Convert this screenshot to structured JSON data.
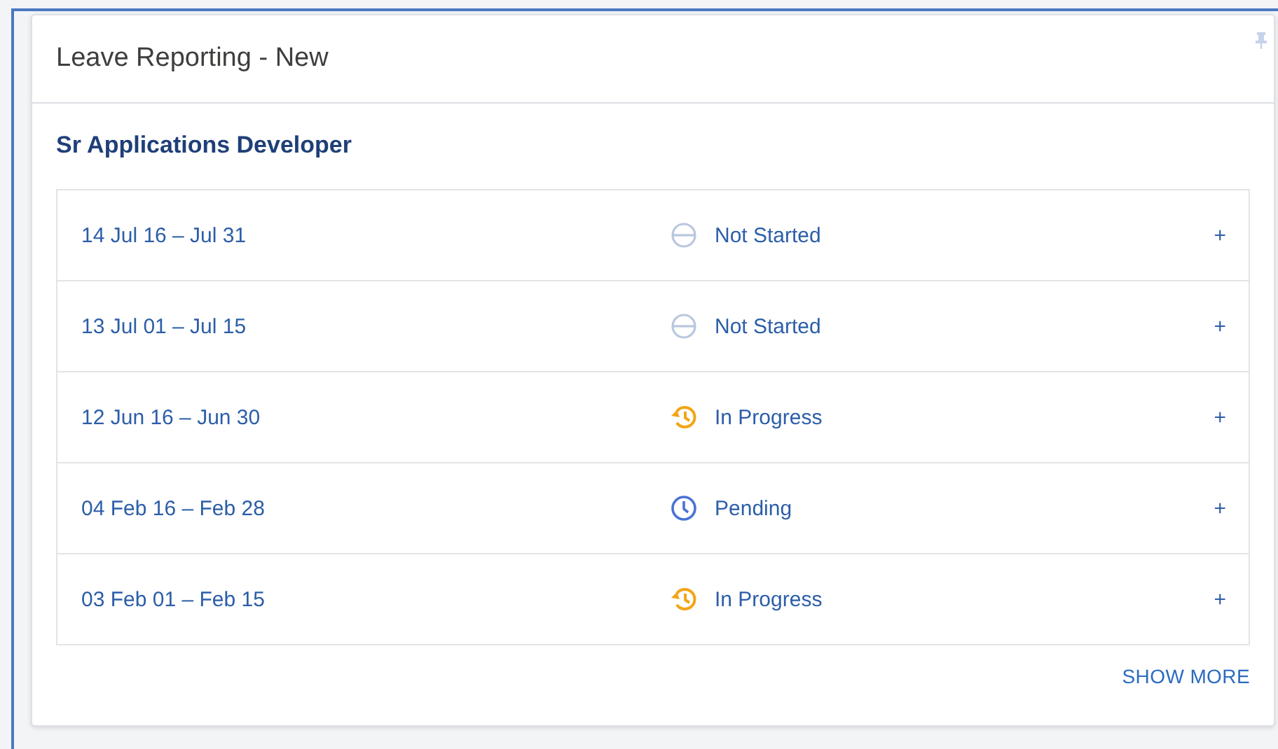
{
  "card": {
    "title": "Leave Reporting - New",
    "subtitle": "Sr Applications Developer",
    "periods": [
      {
        "label": "14 Jul 16 – Jul 31",
        "status": "Not Started",
        "kind": "not_started",
        "action": "+"
      },
      {
        "label": "13 Jul 01 – Jul 15",
        "status": "Not Started",
        "kind": "not_started",
        "action": "+"
      },
      {
        "label": "12 Jun 16 – Jun 30",
        "status": "In Progress",
        "kind": "in_progress",
        "action": "+"
      },
      {
        "label": "04 Feb 16 – Feb 28",
        "status": "Pending",
        "kind": "pending",
        "action": "+"
      },
      {
        "label": "03 Feb 01 – Feb 15",
        "status": "In Progress",
        "kind": "in_progress",
        "action": "+"
      }
    ],
    "show_more": "SHOW MORE"
  }
}
